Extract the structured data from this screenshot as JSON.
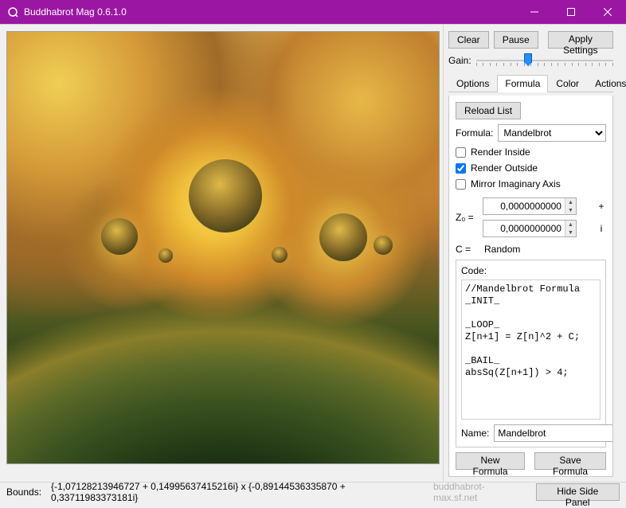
{
  "window": {
    "title": "Buddhabrot Mag 0.6.1.0"
  },
  "toolbar": {
    "clear": "Clear",
    "pause": "Pause",
    "apply": "Apply Settings",
    "gain_label": "Gain:",
    "gain_pos_pct": 38
  },
  "tabs": {
    "options": "Options",
    "formula": "Formula",
    "color": "Color",
    "actions": "Actions",
    "active": "formula"
  },
  "formula_tab": {
    "reload": "Reload List",
    "formula_label": "Formula:",
    "formula_selected": "Mandelbrot",
    "render_inside": {
      "label": "Render Inside",
      "checked": false
    },
    "render_outside": {
      "label": "Render Outside",
      "checked": true
    },
    "mirror_axis": {
      "label": "Mirror Imaginary Axis",
      "checked": false
    },
    "z0_label": "Z₀ =",
    "z0_real": "0,0000000000",
    "z0_plus": "+",
    "z0_imag": "0,0000000000",
    "z0_i": "i",
    "c_label": "C =",
    "c_value": "Random",
    "code_label": "Code:",
    "code": "//Mandelbrot Formula\n_INIT_\n\n_LOOP_\nZ[n+1] = Z[n]^2 + C;\n\n_BAIL_\nabsSq(Z[n+1]) > 4;\n",
    "name_label": "Name:",
    "name_value": "Mandelbrot",
    "new_formula": "New Formula",
    "save_formula": "Save Formula"
  },
  "status": {
    "bounds_label": "Bounds:",
    "bounds_value": "{-1,07128213946727 + 0,14995637415216i} x {-0,89144536335870 + 0,33711983373181i}",
    "link": "buddhabrot-max.sf.net",
    "hide_panel": "Hide Side Panel"
  }
}
